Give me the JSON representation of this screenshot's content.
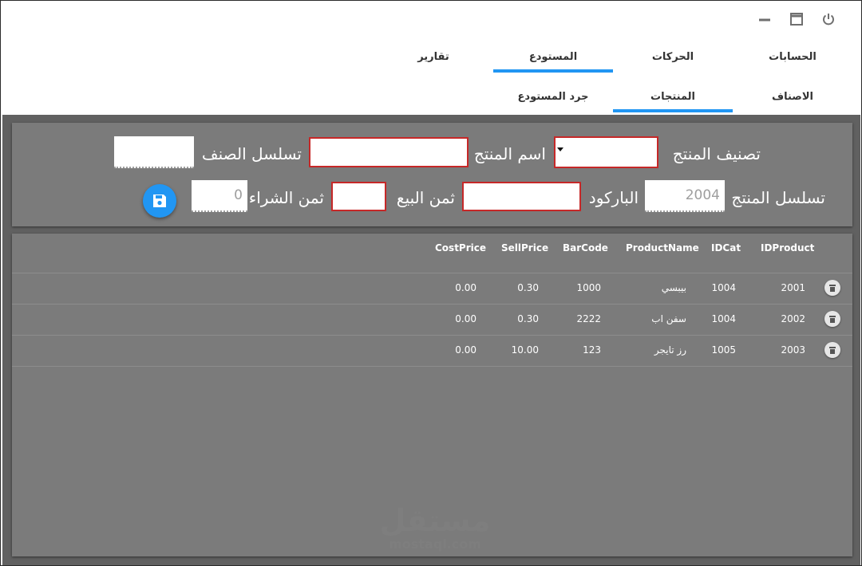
{
  "window": {
    "controls": {
      "power_icon": "power-icon",
      "maximize_icon": "maximize-icon",
      "minimize_icon": "minimize-icon"
    }
  },
  "main_tabs": [
    {
      "label": "الحسابات",
      "active": false
    },
    {
      "label": "الحركات",
      "active": false
    },
    {
      "label": "المستودع",
      "active": true
    },
    {
      "label": "تقارير",
      "active": false
    }
  ],
  "sub_tabs": [
    {
      "label": "الاصناف",
      "active": false
    },
    {
      "label": "المنتجات",
      "active": true
    },
    {
      "label": "جرد المستودع",
      "active": false
    }
  ],
  "form": {
    "category_label": "تصنيف المنتج",
    "category_value": "",
    "name_label": "اسم المنتج",
    "name_value": "",
    "cat_id_label": "تسلسل الصنف",
    "cat_id_value": "",
    "product_id_label": "تسلسل المنتج",
    "product_id_value": "2004",
    "barcode_label": "الباركود",
    "barcode_value": "",
    "sell_label": "ثمن البيع",
    "sell_value": "",
    "cost_label": "ثمن الشراء",
    "cost_value": "0",
    "save_icon": "save-icon"
  },
  "grid": {
    "columns": {
      "id_product": "IDProduct",
      "id_cat": "IDCat",
      "product_name": "ProductName",
      "barcode": "BarCode",
      "sell_price": "SellPrice",
      "cost_price": "CostPrice"
    },
    "rows": [
      {
        "id_product": "2001",
        "id_cat": "1004",
        "product_name": "بيبسي",
        "barcode": "1000",
        "sell_price": "0.30",
        "cost_price": "0.00"
      },
      {
        "id_product": "2002",
        "id_cat": "1004",
        "product_name": "سفن اب",
        "barcode": "2222",
        "sell_price": "0.30",
        "cost_price": "0.00"
      },
      {
        "id_product": "2003",
        "id_cat": "1005",
        "product_name": "رز تايجر",
        "barcode": "123",
        "sell_price": "10.00",
        "cost_price": "0.00"
      }
    ],
    "delete_icon": "delete-icon"
  },
  "watermark": {
    "arabic": "مستقل",
    "latin": "mostaql.com"
  },
  "colors": {
    "accent": "#2196f3",
    "error_border": "#c62828",
    "panel": "#7b7b7b",
    "background": "#616161"
  }
}
